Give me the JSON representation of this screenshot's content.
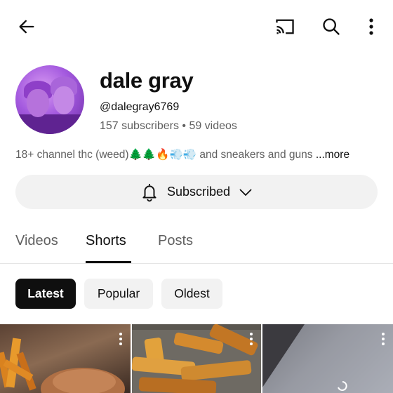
{
  "topbar": {
    "back_icon": "arrow-left-icon",
    "cast_icon": "cast-icon",
    "search_icon": "search-icon",
    "more_icon": "more-vertical-icon"
  },
  "channel": {
    "name": "dale gray",
    "handle": "@dalegray6769",
    "stats": "157 subscribers • 59 videos",
    "description": "18+ channel  thc (weed)🌲🌲🔥💨💨 and sneakers  and guns ",
    "more_label": "...more"
  },
  "subscribe": {
    "label": "Subscribed",
    "bell_icon": "bell-icon",
    "chevron_icon": "chevron-down-icon"
  },
  "tabs": [
    {
      "label": "Videos"
    },
    {
      "label": "Shorts",
      "active": true
    },
    {
      "label": "Posts"
    }
  ],
  "filters": [
    {
      "label": "Latest",
      "active": true
    },
    {
      "label": "Popular"
    },
    {
      "label": "Oldest"
    }
  ],
  "colors": {
    "accent": "#0f0f0f",
    "chip_bg": "#f2f2f2",
    "secondary_text": "#606060"
  }
}
